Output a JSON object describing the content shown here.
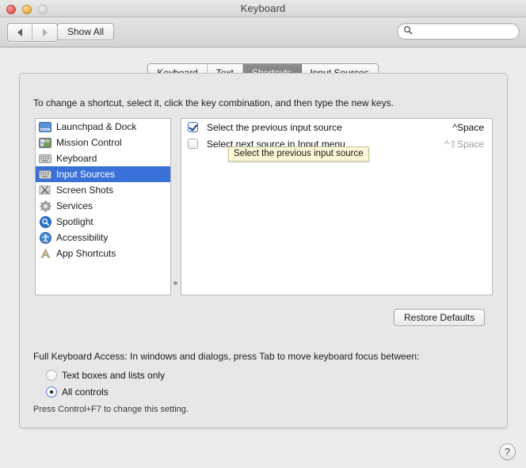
{
  "window": {
    "title": "Keyboard",
    "traffic_lights": [
      {
        "name": "close-button",
        "color": "#e05c54"
      },
      {
        "name": "minimize-button",
        "color": "#e9b04b"
      },
      {
        "name": "zoom-button",
        "color": "#d4d4d4"
      }
    ]
  },
  "toolbar": {
    "back_icon": "triangle-left-icon",
    "forward_icon": "triangle-right-icon",
    "show_all_label": "Show All",
    "search": {
      "icon": "search-icon",
      "value": "",
      "placeholder": ""
    }
  },
  "tabs": [
    {
      "label": "Keyboard",
      "active": false
    },
    {
      "label": "Text",
      "active": false
    },
    {
      "label": "Shortcuts",
      "active": true
    },
    {
      "label": "Input Sources",
      "active": false
    }
  ],
  "pane": {
    "hint": "To change a shortcut, select it, click the key combination, and then type the new keys.",
    "categories": [
      {
        "label": "Launchpad & Dock",
        "icon": "launchpad-dock-icon",
        "selected": false
      },
      {
        "label": "Mission Control",
        "icon": "mission-control-icon",
        "selected": false
      },
      {
        "label": "Keyboard",
        "icon": "keyboard-icon",
        "selected": false
      },
      {
        "label": "Input Sources",
        "icon": "input-sources-icon",
        "selected": true
      },
      {
        "label": "Screen Shots",
        "icon": "screen-shots-icon",
        "selected": false
      },
      {
        "label": "Services",
        "icon": "services-gear-icon",
        "selected": false
      },
      {
        "label": "Spotlight",
        "icon": "spotlight-icon",
        "selected": false
      },
      {
        "label": "Accessibility",
        "icon": "accessibility-icon",
        "selected": false
      },
      {
        "label": "App Shortcuts",
        "icon": "app-shortcuts-icon",
        "selected": false
      }
    ],
    "shortcuts": [
      {
        "label": "Select the previous input source",
        "key": "^Space",
        "checked": true,
        "dim": false
      },
      {
        "label": "Select next source in Input menu",
        "key": "^⇧Space",
        "checked": false,
        "dim": true
      }
    ],
    "tooltip": "Select the previous input source",
    "restore_defaults_label": "Restore Defaults"
  },
  "full_keyboard_access": {
    "label": "Full Keyboard Access: In windows and dialogs, press Tab to move keyboard focus between:",
    "options": [
      {
        "label": "Text boxes and lists only",
        "selected": false
      },
      {
        "label": "All controls",
        "selected": true
      }
    ],
    "note": "Press Control+F7 to change this setting."
  },
  "help": {
    "icon": "help-question-icon",
    "label": "?"
  },
  "colors": {
    "selection_blue": "#3a71d8",
    "tooltip_bg": "#fbf7d6",
    "active_tab_gray": "#777777"
  }
}
